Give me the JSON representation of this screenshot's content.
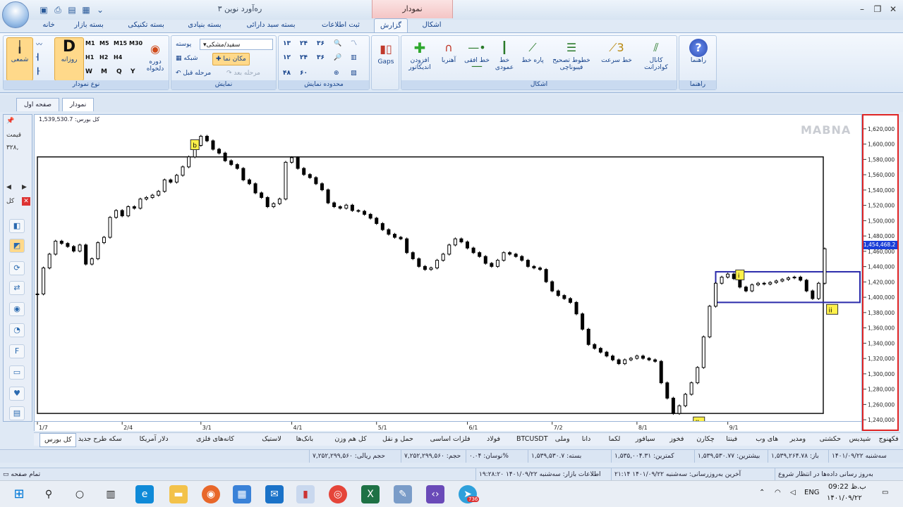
{
  "window": {
    "title": "ره‌آورد نوین ۳",
    "context_tab": "نمودار"
  },
  "ribbon_tabs": [
    "خانه",
    "بسته بازار",
    "بسته تکنیکی",
    "بسته بنیادی",
    "بسته سبد دارائی",
    "ثبت اطلاعات",
    "گزارش",
    "اشکال"
  ],
  "ribbon": {
    "chart_type": {
      "label": "نوع نمودار",
      "candle": "شمعی",
      "daily_letter": "D",
      "daily": "روزانه",
      "custom_period": "دوره دلخواه",
      "periods": [
        "M1",
        "M5",
        "M15",
        "M30",
        "H1",
        "H2",
        "H4",
        "W",
        "M",
        "Q",
        "Y"
      ]
    },
    "display": {
      "label": "نمایش",
      "skin_label": "پوسته",
      "skin_value": "سفید/مشکی",
      "grid": "شبکه",
      "cursor": "مکان نما",
      "prev_step": "مرحله قبل",
      "next_step": "مرحله بعد"
    },
    "range": {
      "label": "محدوده نمایش",
      "items": [
        "۱۳",
        "۲۴",
        "۳۶",
        "۱۲",
        "۲۴",
        "۳۶",
        "۴۸",
        "۶۰"
      ]
    },
    "gaps": "Gaps",
    "shapes": {
      "label": "اشکال",
      "items": [
        "افزودن اندیکاتور",
        "آهنربا",
        "خط افقی",
        "خط عمودی",
        "پاره خط",
        "خطوط تصحیح فیبوناچی",
        "خط سرعت",
        "کانال کوادرانت"
      ]
    },
    "help": {
      "label": "راهنما",
      "button": "راهنما"
    }
  },
  "page_tabs": [
    "نمودار",
    "صفحه اول"
  ],
  "left_panel": {
    "price_label": "قیمت",
    "price_value": "۳۲۸,",
    "total_label": "کل"
  },
  "chart": {
    "legend": "کل بورس: 1,539,530.7",
    "watermark": "MABNA",
    "last_price": "1,454,468.2",
    "yticks": [
      "1,620,000",
      "1,600,000",
      "1,580,000",
      "1,560,000",
      "1,540,000",
      "1,520,000",
      "1,500,000",
      "1,480,000",
      "1,460,000",
      "1,440,000",
      "1,420,000",
      "1,400,000",
      "1,380,000",
      "1,360,000",
      "1,340,000",
      "1,320,000",
      "1,300,000",
      "1,280,000",
      "1,260,000",
      "1,240,000"
    ],
    "xticks": [
      "1/7",
      "2/4",
      "3/1",
      "4/1",
      "5/1",
      "6/1",
      "7/2",
      "8/1",
      "9/1"
    ],
    "annotations": [
      "b",
      "i",
      "ii",
      "II"
    ]
  },
  "chart_data": {
    "type": "candlestick",
    "title": "",
    "ylim": [
      1230000,
      1630000
    ],
    "values": [
      1396000,
      1430000,
      1448000,
      1465000,
      1462000,
      1458000,
      1452000,
      1460000,
      1435000,
      1442000,
      1463000,
      1470000,
      1496000,
      1505000,
      1498000,
      1510000,
      1508000,
      1520000,
      1522000,
      1525000,
      1530000,
      1545000,
      1542000,
      1551000,
      1562000,
      1575000,
      1590000,
      1602000,
      1596000,
      1585000,
      1580000,
      1570000,
      1565000,
      1560000,
      1545000,
      1540000,
      1528000,
      1522000,
      1510000,
      1514000,
      1520000,
      1568000,
      1574000,
      1560000,
      1552000,
      1548000,
      1540000,
      1532000,
      1515000,
      1510000,
      1508000,
      1512000,
      1505000,
      1504000,
      1500000,
      1495000,
      1488000,
      1480000,
      1474000,
      1470000,
      1468000,
      1450000,
      1442000,
      1432000,
      1428000,
      1430000,
      1440000,
      1448000,
      1460000,
      1468000,
      1464000,
      1456000,
      1450000,
      1445000,
      1436000,
      1432000,
      1440000,
      1450000,
      1448000,
      1445000,
      1440000,
      1432000,
      1430000,
      1428000,
      1412000,
      1400000,
      1394000,
      1390000,
      1385000,
      1370000,
      1350000,
      1330000,
      1325000,
      1320000,
      1315000,
      1310000,
      1305000,
      1310000,
      1312000,
      1315000,
      1312000,
      1310000,
      1308000,
      1280000,
      1260000,
      1240000,
      1250000,
      1265000,
      1280000,
      1300000,
      1340000,
      1380000,
      1410000,
      1418000,
      1422000,
      1416000,
      1405000,
      1400000,
      1408000,
      1410000,
      1409000,
      1411000,
      1413000,
      1415000,
      1417000,
      1418000,
      1414000,
      1400000,
      1390000,
      1410000,
      1455000
    ],
    "boxes": [
      {
        "label": "range",
        "x0": 0,
        "x1": 132,
        "y0": 1240000,
        "y1": 1575000
      },
      {
        "label": "consolidation",
        "x0": 112,
        "x1": 133,
        "y0": 1385000,
        "y1": 1425000
      }
    ]
  },
  "symbol_tabs": [
    "کل بورس",
    "سکه طرح جدید",
    "دلار آمریکا",
    "کانه‌های فلزی",
    "لاستیک",
    "بانک‌ها",
    "کل هم وزن",
    "حمل و نقل",
    "فلزات اساسی",
    "فولاد",
    "BTCUSDT",
    "وملی",
    "دانا",
    "لکما",
    "سیافور",
    "فخوز",
    "چکارن",
    "فینتا",
    "های وب",
    "ومدیر",
    "حکشتی",
    "شپدیس",
    "فکهنوج",
    "خ"
  ],
  "status": {
    "date": "سه‌شنبه ۱۴۰۱/۰۹/۲۲",
    "open": "باز: ۱,۵۳۹,۲۶۴.۷۸",
    "high": "بیشترین: ۱,۵۳۹,۵۳۰.۷۷",
    "low": "کمترین: ۱,۵۳۵,۰۰۴.۳۱",
    "close": "بسته: ۱,۵۳۹,۵۳۰.۷",
    "change": "نوسان: ۰.۰۴%",
    "volume": "حجم: ۷,۲۵۲,۲۹۹,۵۶۰",
    "value": "حجم ریالی: ۷,۲۵۲,۲۹۹,۵۶۰",
    "update": "به‌روز رسانی داده‌ها در انتظار شروع",
    "last_update": "آخرین به‌روزرسانی: سه‌شنبه ۱۴۰۱/۰۹/۲۲ ۲۱:۱۴",
    "market_info": "اطلاعات بازار: سه‌شنبه ۱۴۰۱/۰۹/۲۲ ۱۹:۲۸:۲۰",
    "fullscreen": "تمام صفحه"
  },
  "taskbar": {
    "lang": "ENG",
    "time": "ب.ظ 09:22",
    "date": "۱۴۰۱/۰۹/۲۲",
    "badge": "736"
  }
}
